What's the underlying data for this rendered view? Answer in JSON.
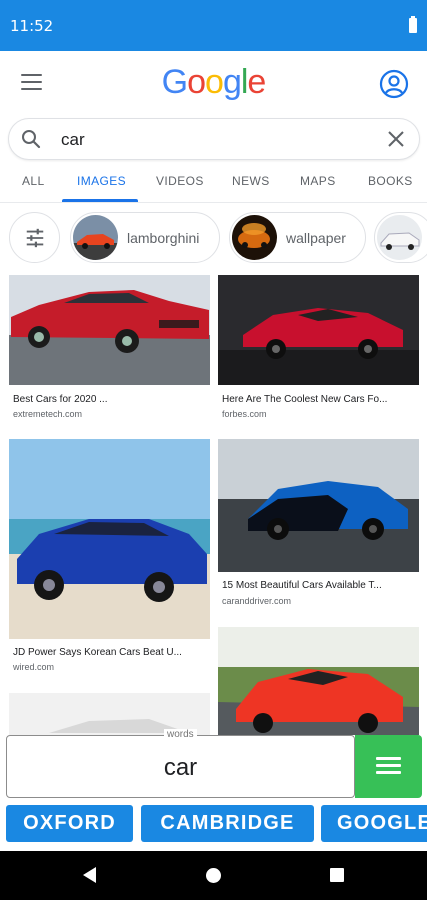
{
  "status_bar": {
    "time": "11:52"
  },
  "header": {
    "logo_letters": [
      {
        "char": "G",
        "color": "#4285F4"
      },
      {
        "char": "o",
        "color": "#EA4335"
      },
      {
        "char": "o",
        "color": "#FBBC05"
      },
      {
        "char": "g",
        "color": "#4285F4"
      },
      {
        "char": "l",
        "color": "#34A853"
      },
      {
        "char": "e",
        "color": "#EA4335"
      }
    ]
  },
  "search": {
    "query": "car"
  },
  "tabs": [
    {
      "label": "ALL"
    },
    {
      "label": "IMAGES",
      "active": true
    },
    {
      "label": "VIDEOS"
    },
    {
      "label": "NEWS"
    },
    {
      "label": "MAPS"
    },
    {
      "label": "BOOKS"
    }
  ],
  "chips": [
    {
      "label": "lamborghini"
    },
    {
      "label": "wallpaper"
    },
    {
      "label": ""
    }
  ],
  "results": [
    {
      "title": "Best Cars for 2020 ...",
      "source": "extremetech.com"
    },
    {
      "title": "Here Are The Coolest New Cars Fo...",
      "source": "forbes.com"
    },
    {
      "title": "JD Power Says Korean Cars Beat U...",
      "source": "wired.com"
    },
    {
      "title": "15 Most Beautiful Cars Available T...",
      "source": "caranddriver.com"
    }
  ],
  "dictionary": {
    "word_label": "words",
    "word": "car",
    "buttons": [
      {
        "label": "OXFORD"
      },
      {
        "label": "CAMBRIDGE"
      },
      {
        "label": "GOOGLE"
      }
    ]
  },
  "colors": {
    "status_bar": "#1a88e2",
    "accent_blue": "#1a73e8",
    "green_button": "#37c057"
  }
}
